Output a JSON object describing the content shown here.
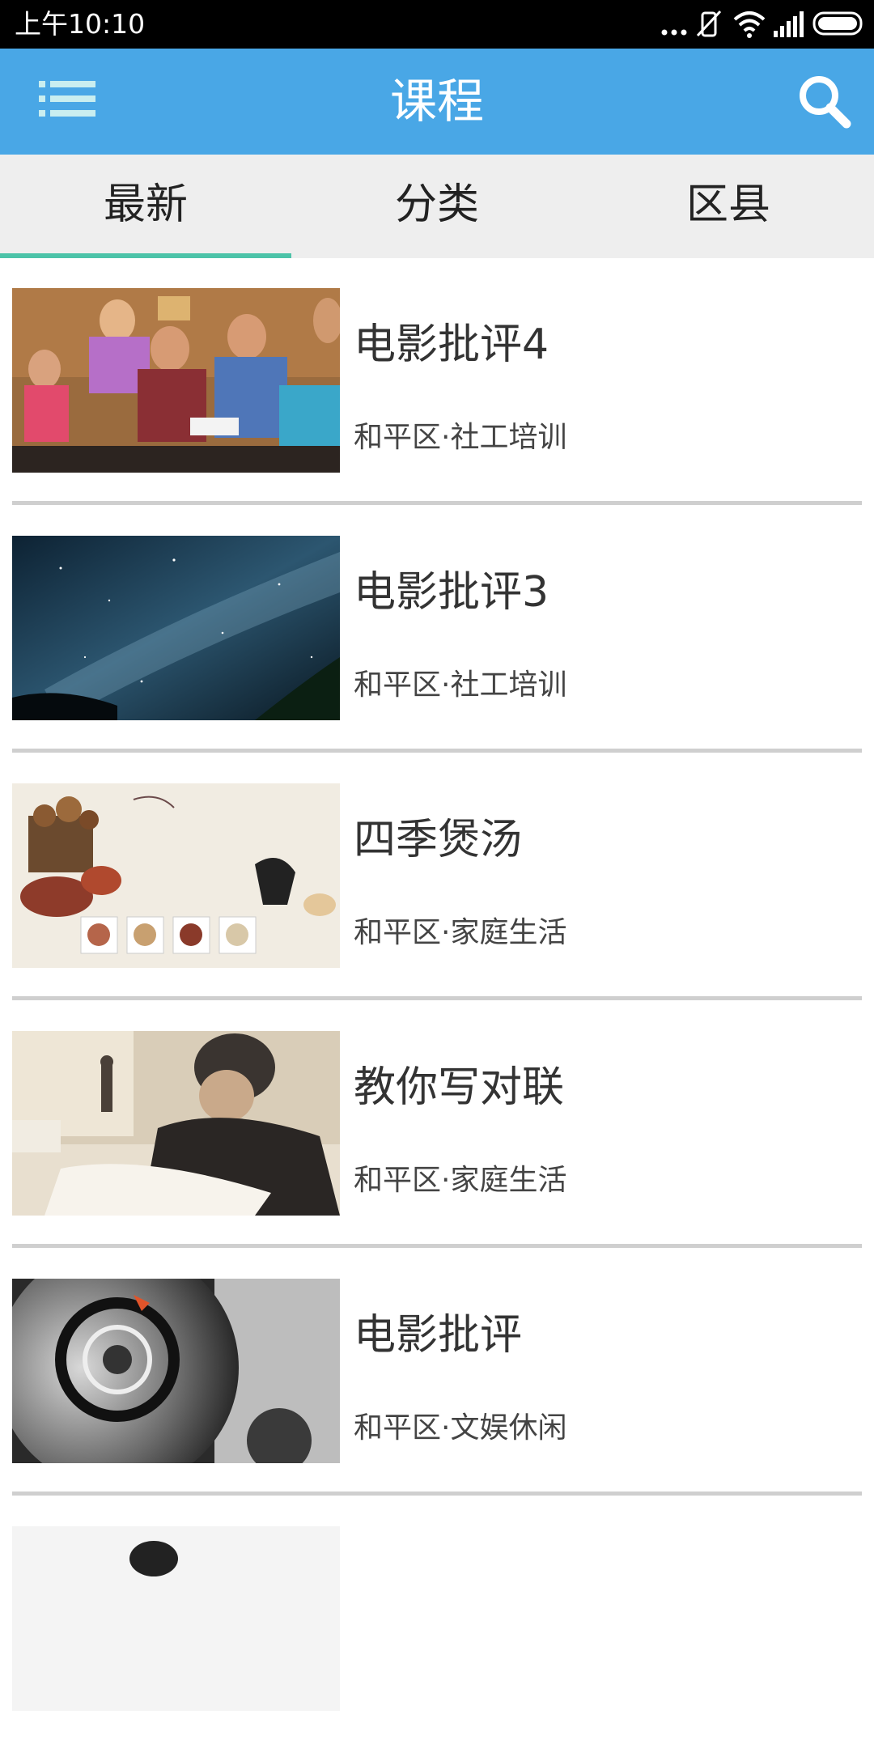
{
  "status_bar": {
    "time": "上午10:10",
    "icons": [
      "more-dots-icon",
      "vibrate-off-icon",
      "wifi-icon",
      "signal-icon",
      "battery-icon"
    ]
  },
  "app_bar": {
    "title": "课程",
    "menu_icon": "list-menu-icon",
    "search_icon": "search-icon",
    "background_color": "#49a7e6"
  },
  "tabs": {
    "items": [
      {
        "label": "最新",
        "selected": true
      },
      {
        "label": "分类",
        "selected": false
      },
      {
        "label": "区县",
        "selected": false
      }
    ],
    "indicator_color": "#4cc3a8"
  },
  "courses": [
    {
      "title": "电影批评4",
      "subtitle": "和平区·社工培训",
      "thumbnail": "group-meeting-photo"
    },
    {
      "title": "电影批评3",
      "subtitle": "和平区·社工培训",
      "thumbnail": "starry-sky-photo"
    },
    {
      "title": "四季煲汤",
      "subtitle": "和平区·家庭生活",
      "thumbnail": "herbal-soup-photo"
    },
    {
      "title": "教你写对联",
      "subtitle": "和平区·家庭生活",
      "thumbnail": "elder-writing-photo"
    },
    {
      "title": "电影批评",
      "subtitle": "和平区·文娱休闲",
      "thumbnail": "camera-dial-photo"
    }
  ]
}
